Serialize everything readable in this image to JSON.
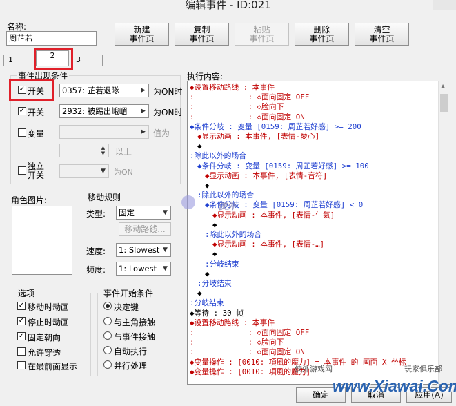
{
  "window": {
    "title": "编辑事件 - ID:021"
  },
  "name": {
    "label": "名称:",
    "value": "周芷若"
  },
  "toolbar": {
    "new": [
      "新建",
      "事件页"
    ],
    "copy": [
      "复制",
      "事件页"
    ],
    "paste": [
      "粘贴",
      "事件页"
    ],
    "delete": [
      "删除",
      "事件页"
    ],
    "clear": [
      "清空",
      "事件页"
    ]
  },
  "tabs": [
    "1",
    "2",
    "3"
  ],
  "conditions": {
    "title": "事件出现条件",
    "switch1": {
      "label": "开关",
      "value": "0357: 芷若退隊",
      "suffix": "为ON时",
      "checked": true
    },
    "switch2": {
      "label": "开关",
      "value": "2932: 被踢出峨嵋",
      "suffix": "为ON时",
      "checked": true
    },
    "variable": {
      "label": "变量",
      "suffix": "值为",
      "more": "以上",
      "checked": false
    },
    "self_switch": {
      "label1": "独立",
      "label2": "开关",
      "suffix": "为ON",
      "checked": false
    }
  },
  "graphic": {
    "title": "角色图片:"
  },
  "movement": {
    "title": "移动规则",
    "type_label": "类型:",
    "type_value": "固定",
    "route_button": "移动路线...",
    "speed_label": "速度:",
    "speed_value": "1: Slowest",
    "freq_label": "频度:",
    "freq_value": "1: Lowest"
  },
  "options": {
    "title": "选项",
    "items": [
      {
        "label": "移动时动画",
        "checked": true
      },
      {
        "label": "停止时动画",
        "checked": true
      },
      {
        "label": "固定朝向",
        "checked": true
      },
      {
        "label": "允许穿透",
        "checked": false
      },
      {
        "label": "在最前面显示",
        "checked": false
      }
    ]
  },
  "trigger": {
    "title": "事件开始条件",
    "items": [
      {
        "label": "决定键",
        "selected": true
      },
      {
        "label": "与主角接触",
        "selected": false
      },
      {
        "label": "与事件接触",
        "selected": false
      },
      {
        "label": "自动执行",
        "selected": false
      },
      {
        "label": "并行处理",
        "selected": false
      }
    ]
  },
  "exec": {
    "title": "执行内容:",
    "lines": [
      {
        "t": "◆设置移动路线 : 本事件",
        "c": "r",
        "i": 0
      },
      {
        "t": ":            : ◇面向固定 OFF",
        "c": "r",
        "i": 0
      },
      {
        "t": ":            : ◇脸向下",
        "c": "r",
        "i": 0
      },
      {
        "t": ":            : ◇面向固定 ON",
        "c": "r",
        "i": 0
      },
      {
        "t": "◆条件分岐 : 变量 [0159: 周芷若好感] >= 200",
        "c": "b",
        "i": 0
      },
      {
        "t": "◆显示动画 : 本事件, [表情-愛心]",
        "c": "m",
        "i": 1
      },
      {
        "t": "◆",
        "c": "k",
        "i": 1
      },
      {
        "t": ":除此以外的场合",
        "c": "b",
        "i": 0
      },
      {
        "t": "◆条件分岐 : 变量 [0159: 周芷若好感] >= 100",
        "c": "b",
        "i": 1
      },
      {
        "t": "◆显示动画 : 本事件, [表情-音符]",
        "c": "m",
        "i": 2
      },
      {
        "t": "◆",
        "c": "k",
        "i": 2
      },
      {
        "t": ":除此以外的场合",
        "c": "b",
        "i": 1
      },
      {
        "t": "◆条件分岐 : 变量 [0159: 周芷若好感] < 0",
        "c": "b",
        "i": 2
      },
      {
        "t": "◆显示动画 : 本事件, [表情-生氣]",
        "c": "m",
        "i": 3
      },
      {
        "t": "◆",
        "c": "k",
        "i": 3
      },
      {
        "t": ":除此以外的场合",
        "c": "b",
        "i": 2
      },
      {
        "t": "◆显示动画 : 本事件, [表情-…]",
        "c": "m",
        "i": 3
      },
      {
        "t": "◆",
        "c": "k",
        "i": 3
      },
      {
        "t": ":分岐结束",
        "c": "b",
        "i": 2
      },
      {
        "t": "◆",
        "c": "k",
        "i": 2
      },
      {
        "t": ":分岐结束",
        "c": "b",
        "i": 1
      },
      {
        "t": "◆",
        "c": "k",
        "i": 1
      },
      {
        "t": ":分岐结束",
        "c": "b",
        "i": 0
      },
      {
        "t": "◆等待 : 30 帧",
        "c": "k",
        "i": 0
      },
      {
        "t": "◆设置移动路线 : 本事件",
        "c": "r",
        "i": 0
      },
      {
        "t": ":            : ◇面向固定 OFF",
        "c": "r",
        "i": 0
      },
      {
        "t": ":            : ◇脸向下",
        "c": "r",
        "i": 0
      },
      {
        "t": ":            : ◇面向固定 ON",
        "c": "r",
        "i": 0
      },
      {
        "t": "◆变量操作 : [0010: 項風的魔力] = 本事件 的 画面 X 坐标",
        "c": "r",
        "i": 0
      },
      {
        "t": "◆变量操作 : [0010: 項風的魔力]",
        "c": "r",
        "i": 0
      }
    ]
  },
  "bottom": {
    "ok": "确定",
    "cancel": "取消",
    "apply": "应用(A)"
  },
  "watermark": {
    "site": "www.Xiawai.Com",
    "club": "玩家俱乐部",
    "game": "侠外游戏网",
    "logo": "侠外"
  }
}
